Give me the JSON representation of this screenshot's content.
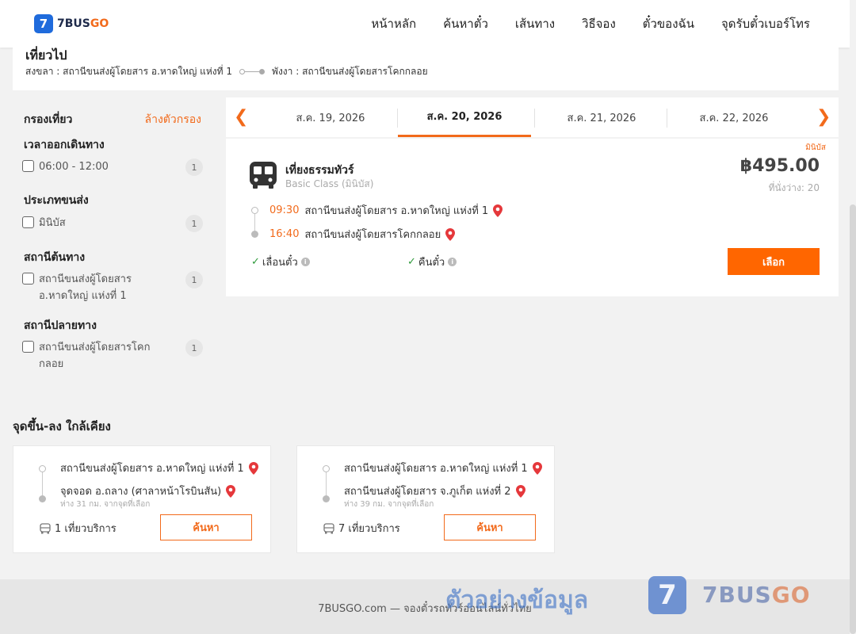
{
  "header": {
    "logo_mark": "7",
    "logo_text": "7BUS",
    "logo_text_accent": "GO",
    "nav": [
      "หน้าหลัก",
      "ค้นหาตั๋ว",
      "เส้นทาง",
      "วิธีจอง",
      "ตั๋วของฉัน",
      "จุดรับตั๋วเบอร์โทร"
    ]
  },
  "route": {
    "title": "เที่ยวไป",
    "from": "สงขลา : สถานีขนส่งผู้โดยสาร อ.หาดใหญ่ แห่งที่ 1",
    "to": "พังงา : สถานีขนส่งผู้โดยสารโคกกลอย"
  },
  "filters": {
    "title": "กรองเที่ยว",
    "clear": "ล้างตัวกรอง",
    "groups": [
      {
        "title": "เวลาออกเดินทาง",
        "option": "06:00 - 12:00",
        "count": "1"
      },
      {
        "title": "ประเภทขนส่ง",
        "option": "มินิบัส",
        "count": "1"
      },
      {
        "title": "สถานีต้นทาง",
        "option": "สถานีขนส่งผู้โดยสาร อ.หาดใหญ่ แห่งที่ 1",
        "count": "1"
      },
      {
        "title": "สถานีปลายทาง",
        "option": "สถานีขนส่งผู้โดยสารโคกกลอย",
        "count": "1"
      }
    ]
  },
  "dates": {
    "tabs": [
      "ส.ค. 19, 2026",
      "ส.ค. 20, 2026",
      "ส.ค. 21, 2026",
      "ส.ค. 22, 2026"
    ],
    "active": "ส.ค. 20, 2026"
  },
  "trip": {
    "tag": "มินิบัส",
    "operator": "เที่ยงธรรมทัวร์",
    "class": "Basic Class (มินิบัส)",
    "price": "฿495.00",
    "seats": "ที่นั่งว่าง: 20",
    "depart_time": "09:30",
    "depart_station": "สถานีขนส่งผู้โดยสาร อ.หาดใหญ่ แห่งที่ 1",
    "arrive_time": "16:40",
    "arrive_station": "สถานีขนส่งผู้โดยสารโคกกลอย",
    "policy_reschedule": "เลื่อนตั๋ว",
    "policy_refund": "คืนตั๋ว",
    "select_label": "เลือก"
  },
  "nearby": {
    "title": "จุดขึ้น-ลง ใกล้เคียง",
    "cards": [
      {
        "from": "สถานีขนส่งผู้โดยสาร อ.หาดใหญ่ แห่งที่ 1",
        "to": "จุดจอด อ.ถลาง (ศาลาหน้าโรบินสัน)",
        "distance": "ห่าง 31 กม. จากจุดที่เลือก",
        "trips": "1 เที่ยวบริการ",
        "button": "ค้นหา"
      },
      {
        "from": "สถานีขนส่งผู้โดยสาร อ.หาดใหญ่ แห่งที่ 1",
        "to": "สถานีขนส่งผู้โดยสาร จ.ภูเก็ต แห่งที่ 2",
        "distance": "ห่าง 39 กม. จากจุดที่เลือก",
        "trips": "7 เที่ยวบริการ",
        "button": "ค้นหา"
      }
    ]
  },
  "footer": {
    "text": "7BUSGO.com — จองตั๋วรถทัวร์ออนไลน์ทั่วไทย"
  },
  "watermark": {
    "text": "ตัวอย่างข้อมูล",
    "logo_mark": "7",
    "brand": "7BUS",
    "brand_accent": "GO"
  },
  "colors": {
    "accent": "#f26a1b",
    "button": "#ff6600",
    "brand_blue": "#1f6bdc",
    "check_green": "#2e9a3b"
  }
}
